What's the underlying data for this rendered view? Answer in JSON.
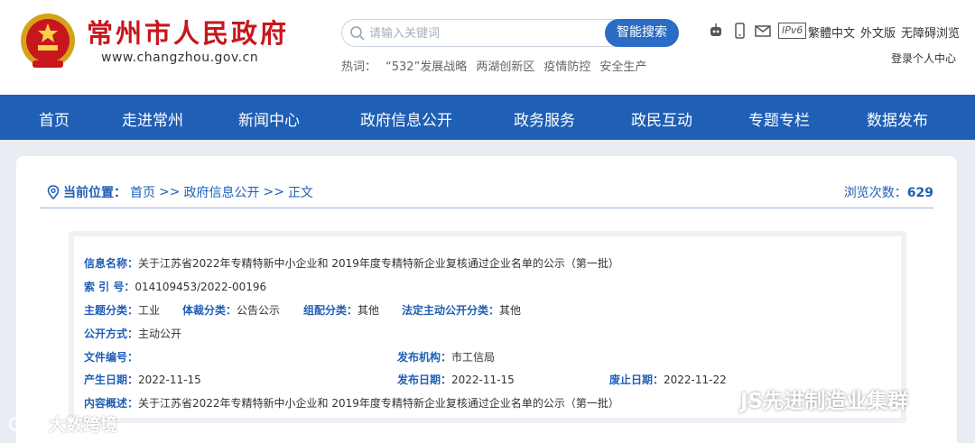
{
  "header": {
    "site_title": "常州市人民政府",
    "site_url": "www.changzhou.gov.cn",
    "search_placeholder": "请输入关键词",
    "search_button": "智能搜索",
    "hotwords_label": "热词：",
    "hotwords": [
      "“532”发展战略",
      "两湖创新区",
      "疫情防控",
      "安全生产"
    ],
    "ipv6_label": "IPv6",
    "util_links": [
      "繁體中文",
      "外文版",
      "无障碍浏览"
    ],
    "login": "登录个人中心"
  },
  "nav": {
    "items": [
      "首页",
      "走进常州",
      "新闻中心",
      "政府信息公开",
      "政务服务",
      "政民互动",
      "专题专栏",
      "数据发布"
    ]
  },
  "breadcrumb": {
    "label": "当前位置：",
    "items": [
      "首页",
      "政府信息公开",
      "正文"
    ],
    "separator": ">>"
  },
  "views": {
    "label": "浏览次数：",
    "count": "629"
  },
  "meta": {
    "info_name_label": "信息名称：",
    "info_name": "关于江苏省2022年专精特新中小企业和 2019年度专精特新企业复核通过企业名单的公示（第一批）",
    "index_label": "索 引 号：",
    "index": "014109453/2022-00196",
    "topic_label": "主题分类：",
    "topic": "工业",
    "genre_label": "体裁分类：",
    "genre": "公告公示",
    "org_label": "组配分类：",
    "org": "其他",
    "legal_label": "法定主动公开分类：",
    "legal": "其他",
    "method_label": "公开方式：",
    "method": "主动公开",
    "docno_label": "文件编号：",
    "docno": "",
    "publisher_label": "发布机构：",
    "publisher": "市工信局",
    "created_label": "产生日期：",
    "created": "2022-11-15",
    "published_label": "发布日期：",
    "published": "2022-11-15",
    "expire_label": "废止日期：",
    "expire": "2022-11-22",
    "summary_label": "内容概述：",
    "summary": "关于江苏省2022年专精特新中小企业和 2019年度专精特新企业复核通过企业名单的公示（第一批）"
  },
  "watermarks": {
    "left": "大数跨境",
    "right": "JS先进制造业集群"
  },
  "colors": {
    "brand_red": "#c8161d",
    "nav_blue": "#1f5fb5",
    "button_blue": "#2b6cc4"
  }
}
